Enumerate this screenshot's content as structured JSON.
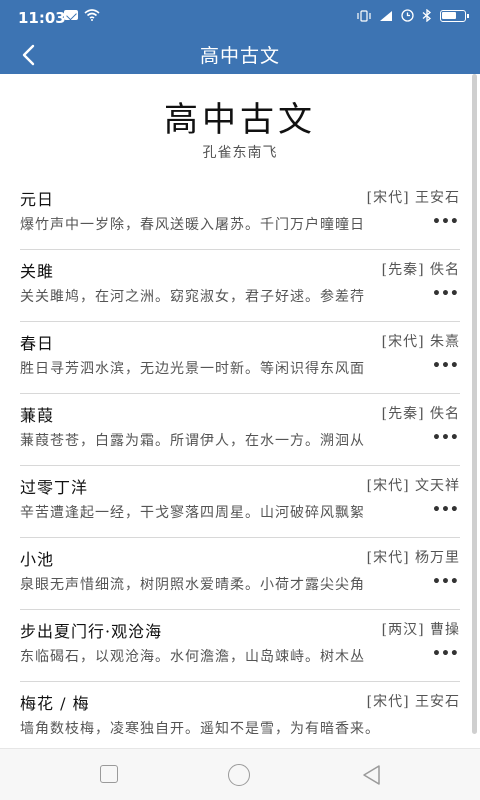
{
  "status_bar": {
    "time": "11:03"
  },
  "header": {
    "title": "高中古文"
  },
  "page": {
    "title": "高中古文",
    "subtitle": "孔雀东南飞"
  },
  "poems": [
    {
      "title": "元日",
      "meta": "[宋代] 王安石",
      "excerpt": "爆竹声中一岁除，春风送暖入屠苏。千门万户曈曈日"
    },
    {
      "title": "关雎",
      "meta": "[先秦] 佚名",
      "excerpt": "关关雎鸠，在河之洲。窈窕淑女，君子好逑。参差荇"
    },
    {
      "title": "春日",
      "meta": "[宋代] 朱熹",
      "excerpt": "胜日寻芳泗水滨，无边光景一时新。等闲识得东风面"
    },
    {
      "title": "蒹葭",
      "meta": "[先秦] 佚名",
      "excerpt": "蒹葭苍苍，白露为霜。所谓伊人，在水一方。溯洄从"
    },
    {
      "title": "过零丁洋",
      "meta": "[宋代] 文天祥",
      "excerpt": "辛苦遭逢起一经，干戈寥落四周星。山河破碎风飘絮"
    },
    {
      "title": "小池",
      "meta": "[宋代] 杨万里",
      "excerpt": "泉眼无声惜细流，树阴照水爱晴柔。小荷才露尖尖角"
    },
    {
      "title": "步出夏门行·观沧海",
      "meta": "[两汉] 曹操",
      "excerpt": "东临碣石，以观沧海。水何澹澹，山岛竦峙。树木丛"
    },
    {
      "title": "梅花 / 梅",
      "meta": "[宋代] 王安石",
      "excerpt": "墙角数枝梅，凌寒独自开。遥知不是雪，为有暗香来。"
    }
  ],
  "ellipsis": "•••",
  "colors": {
    "header_bg": "#3d74b3",
    "text": "#111111",
    "muted": "#555555"
  }
}
